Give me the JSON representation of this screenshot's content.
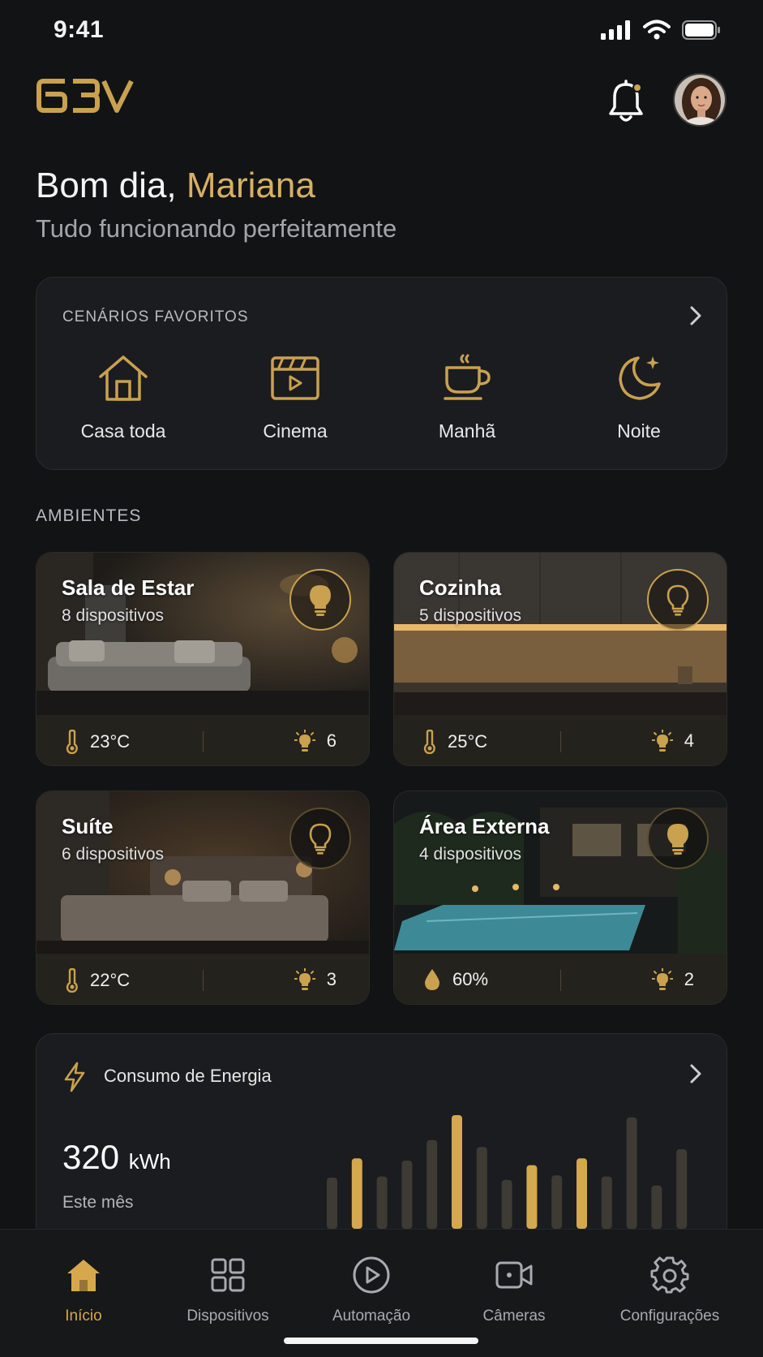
{
  "status_bar": {
    "time": "9:41"
  },
  "header": {
    "logo_text": "63V",
    "notification_icon": "bell-icon",
    "avatar": "user-avatar"
  },
  "greeting": {
    "prefix": "Bom dia, ",
    "name": "Mariana",
    "subtitle": "Tudo funcionando perfeitamente"
  },
  "favorites": {
    "title": "CENÁRIOS FAVORITOS",
    "items": [
      {
        "label": "Casa toda",
        "icon": "home-icon"
      },
      {
        "label": "Cinema",
        "icon": "film-icon"
      },
      {
        "label": "Manhã",
        "icon": "coffee-icon"
      },
      {
        "label": "Noite",
        "icon": "moon-icon"
      }
    ]
  },
  "rooms_section": {
    "title": "AMBIENTES"
  },
  "rooms": [
    {
      "name": "Sala de Estar",
      "devices": "8 dispositivos",
      "left_value": "23°C",
      "left_icon": "thermometer-icon",
      "lights": "6",
      "light_on": true
    },
    {
      "name": "Cozinha",
      "devices": "5 dispositivos",
      "left_value": "25°C",
      "left_icon": "thermometer-icon",
      "lights": "4",
      "light_on": true
    },
    {
      "name": "Suíte",
      "devices": "6 dispositivos",
      "left_value": "22°C",
      "left_icon": "thermometer-icon",
      "lights": "3",
      "light_on": false
    },
    {
      "name": "Área Externa",
      "devices": "4 dispositivos",
      "left_value": "60%",
      "left_icon": "droplet-icon",
      "lights": "2",
      "light_on": true
    }
  ],
  "energy": {
    "title": "Consumo de Energia",
    "value": "320",
    "unit": "kWh",
    "period": "Este mês",
    "bars": [
      0.45,
      0.62,
      0.46,
      0.6,
      0.78,
      1.0,
      0.72,
      0.43,
      0.56,
      0.47,
      0.62,
      0.46,
      0.98,
      0.38,
      0.7
    ],
    "highlight": [
      1,
      5,
      8,
      10
    ]
  },
  "nav": {
    "items": [
      {
        "label": "Início",
        "icon": "home-icon",
        "active": true
      },
      {
        "label": "Dispositivos",
        "icon": "grid-icon",
        "active": false
      },
      {
        "label": "Automação",
        "icon": "play-circle-icon",
        "active": false
      },
      {
        "label": "Câmeras",
        "icon": "video-camera-icon",
        "active": false
      },
      {
        "label": "Configurações",
        "icon": "gear-icon",
        "active": false
      }
    ]
  },
  "colors": {
    "accent": "#d7b063",
    "background": "#121315",
    "card": "#1b1c1f"
  }
}
